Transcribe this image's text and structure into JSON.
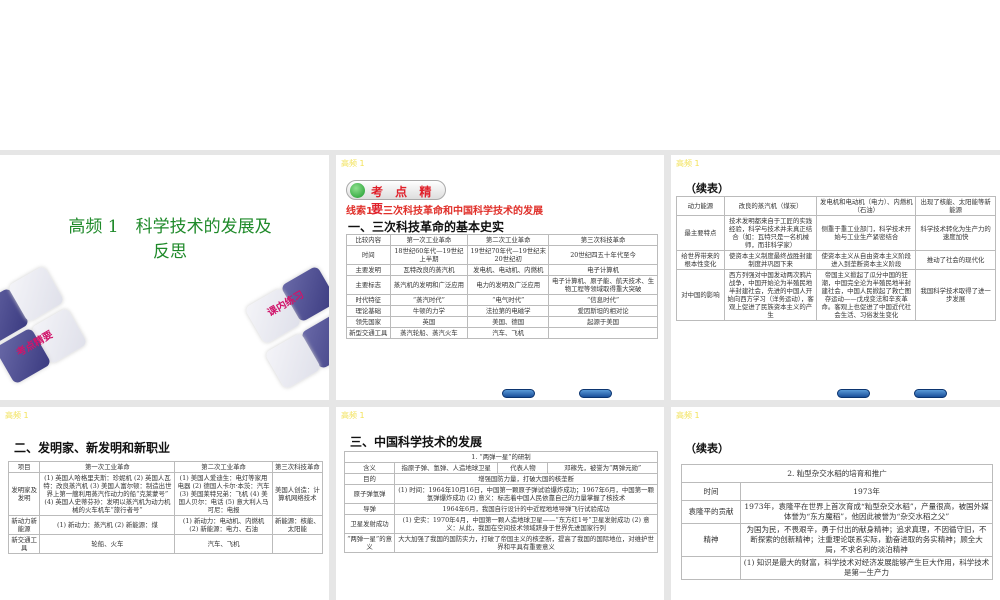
{
  "tag": "高频 1",
  "cover": {
    "title": "高频 1　科学技术的发展及反思",
    "stamp_left": "考点精要",
    "stamp_right": "课内练习"
  },
  "s1": {
    "badge": "考 点 精 要",
    "clue": "线索1　三次科技革命和中国科学技术的发展",
    "heading": "一、三次科技革命的基本史实",
    "rows": [
      [
        "比较内容",
        "第一次工业革命",
        "第二次工业革命",
        "第三次科技革命"
      ],
      [
        "时间",
        "18世纪60年代—19世纪上半期",
        "19世纪70年代—19世纪末20世纪初",
        "20世纪四五十年代至今"
      ],
      [
        "主要发明",
        "瓦特改良的蒸汽机",
        "发电机、电动机、内燃机",
        "电子计算机"
      ],
      [
        "主要标志",
        "蒸汽机的发明和广泛应用",
        "电力的发明及广泛应用",
        "电子计算机、原子能、航天技术、生物工程等领域取得重大突破"
      ],
      [
        "时代特征",
        "“蒸汽时代”",
        "“电气时代”",
        "“信息时代”"
      ],
      [
        "理论基础",
        "牛顿的力学",
        "法拉第的电磁学",
        "爱因斯坦的相对论"
      ],
      [
        "领先国家",
        "英国",
        "美国、德国",
        "起源于美国"
      ],
      [
        "新型交通工具",
        "蒸汽轮船、蒸汽火车",
        "汽车、飞机",
        ""
      ]
    ]
  },
  "s2": {
    "heading": "（续表）",
    "rows": [
      [
        "动力能源",
        "改良的蒸汽机（煤炭）",
        "发电机和电动机（电力）、内燃机（石油）",
        "出现了核能、太阳能等新能源"
      ],
      [
        "最主要特点",
        "技术发明都来自于工匠的实践经验，科学与技术并未真正结合（如：瓦特只是一名机械师，而非科学家）",
        "侧重于重工业部门，科学技术开始与工业生产紧密结合",
        "科学技术转化为生产力的速度加快"
      ],
      [
        "给世界带来的根本性变化",
        "使资本主义制度最终战胜封建制度并巩固下来",
        "使资本主义从自由资本主义阶段进入到垄断资本主义阶段",
        "推动了社会的现代化"
      ],
      [
        "对中国的影响",
        "西方列强对中国发动两次鸦片战争，中国开始沦为半殖民地半封建社会，先进的中国人开始向西方学习（洋务运动），客观上促进了民族资本主义的产生",
        "帝国主义掀起了瓜分中国的狂潮，中国完全沦为半殖民地半封建社会，中国人民掀起了救亡图存运动——戊戌变法和辛亥革命。客观上也促进了中国近代社会生活、习俗发生变化",
        "我国科学技术取得了进一步发展"
      ]
    ]
  },
  "s3": {
    "heading": "二、发明家、新发明和新职业",
    "rows": [
      [
        "项目",
        "第一次工业革命",
        "第二次工业革命",
        "第三次科技革命"
      ],
      [
        "发明家及发明",
        "(1) 英国人哈格里夫斯：珍妮机 (2) 英国人瓦特：改良蒸汽机 (3) 美国人富尔顿：制造出世界上第一艘利用蒸汽作动力的船“克莱蒙号” (4) 英国人史蒂芬孙：发明以蒸汽机为动力机械的火车机车“旅行者号”",
        "(1) 美国人爱迪生：电灯等家用电器 (2) 德国人卡尔·本茨：汽车 (3) 美国莱特兄弟：飞机 (4) 美国人贝尔：电话 (5) 意大利人马可尼：电报",
        "美国人创造：计算机网络技术"
      ],
      [
        "新动力新能源",
        "(1) 新动力：蒸汽机 (2) 新能源：煤",
        "(1) 新动力：电动机、内燃机 (2) 新能源：电力、石油",
        "新能源：核能、太阳能"
      ],
      [
        "新交通工具",
        "轮船、火车",
        "汽车、飞机",
        ""
      ]
    ]
  },
  "s4": {
    "heading": "三、中国科学技术的发展",
    "title": "1. “两弹一星”的研制",
    "meaning": [
      "含义",
      "指原子弹、氢弹、人造地球卫星",
      "代表人物",
      "邓稼先，被誉为“两弹元勋”"
    ],
    "rows": [
      [
        "目的",
        "增强国防力量，打破大国的核垄断"
      ],
      [
        "原子弹氢弹",
        "(1) 时间：1964年10月16日，中国第一颗原子弹试验爆炸成功；1967年6月，中国第一颗氢弹爆炸成功 (2) 意义：标志着中国人民依靠自己的力量掌握了核技术"
      ],
      [
        "导弹",
        "1964年6月，我国自行设计的中近程地地导弹飞行试验成功"
      ],
      [
        "卫星发射成功",
        "(1) 史实：1970年4月，中国第一颗人造地球卫星——“东方红1号”卫星发射成功 (2) 意义：从此，我国在空间技术领域跻身于世界先进国家行列"
      ],
      [
        "“两弹一星”的意义",
        "大大加强了我国的国防实力，打破了帝国主义的核垄断，提高了我国的国际地位，对维护世界和平具有重要意义"
      ]
    ]
  },
  "s5": {
    "heading": "（续表）",
    "title": "2. 籼型杂交水稻的培育和推广",
    "rows": [
      [
        "时间",
        "1973年"
      ],
      [
        "袁隆平的贡献",
        "1973年，袁隆平在世界上首次育成“籼型杂交水稻”，产量很高，被国外媒体誉为“东方魔稻”，他因此被誉为“杂交水稻之父”"
      ],
      [
        "精神",
        "为国为民，不畏艰辛，勇于付出的献身精神；追求真理，不因循守旧，不断探索的创新精神；注重理论联系实际，勤奋进取的务实精神；顾全大局，不求名利的淡泊精神"
      ],
      [
        "",
        "(1) 知识是最大的财富，科学技术对经济发展能够产生巨大作用，科学技术是第一生产力"
      ]
    ]
  }
}
